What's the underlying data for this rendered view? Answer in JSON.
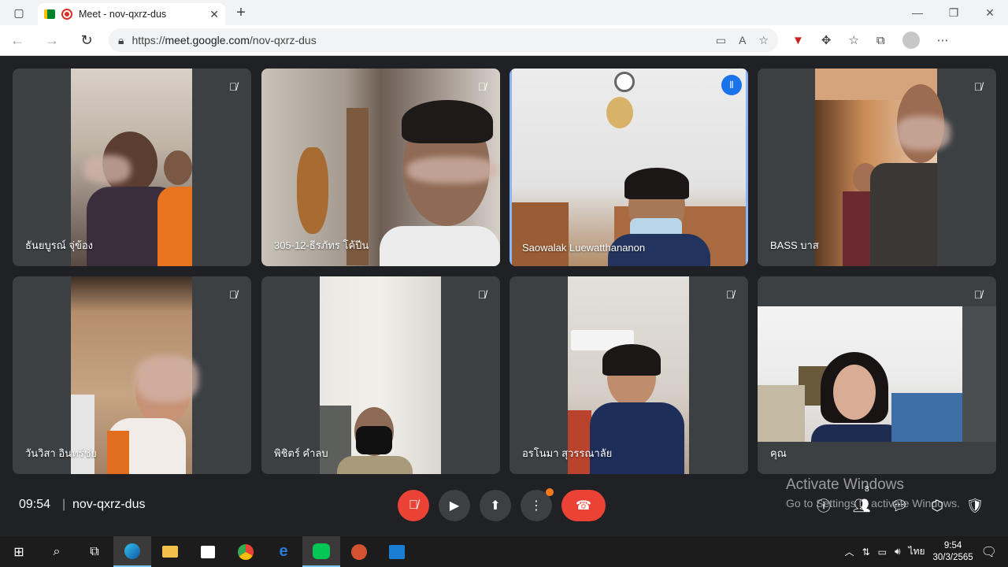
{
  "browser": {
    "tab_title": "Meet - nov-qxrz-dus",
    "url_protocol": "https://",
    "url_host": "meet.google.com",
    "url_path": "/nov-qxrz-dus",
    "icons": [
      "sidebar-icon",
      "meet-icon",
      "record-icon",
      "close-icon",
      "new-tab-icon",
      "back-icon",
      "forward-icon",
      "reload-icon",
      "lock-icon",
      "camera-icon",
      "read-aloud-icon",
      "favorite-add-icon",
      "extension-icon",
      "favorites-icon",
      "collections-icon",
      "profile-icon",
      "more-icon"
    ]
  },
  "participants": [
    {
      "name": "ธันยบูรณ์ จุ่ข้อง",
      "muted": true,
      "active": false
    },
    {
      "name": "305-12-ธีรภัทร โค้ปีน",
      "muted": true,
      "active": false
    },
    {
      "name": "Saowalak Luewatthananon",
      "muted": false,
      "active": true
    },
    {
      "name": "BASS บาส",
      "muted": true,
      "active": false
    },
    {
      "name": "วันวิสา อินทร์ชัย",
      "muted": true,
      "active": false
    },
    {
      "name": "พิชิตร์ คำลบ",
      "muted": true,
      "active": false
    },
    {
      "name": "อรโนมา สุวรรณาลัย",
      "muted": true,
      "active": false
    },
    {
      "name": "คุณ",
      "muted": true,
      "active": false
    }
  ],
  "watermark": {
    "line1": "Activate Windows",
    "line2": "Go to Settings to activate Windows."
  },
  "meeting": {
    "time": "09:54",
    "separator": "|",
    "code": "nov-qxrz-dus",
    "people_count": "8"
  },
  "taskbar": {
    "language": "ไทย",
    "clock_time": "9:54",
    "clock_date": "30/3/2565"
  },
  "colors": {
    "active_outline": "#8ab4f8",
    "end_call": "#ea4335",
    "mic_off": "#ea4335",
    "speaking": "#1a73e8"
  }
}
